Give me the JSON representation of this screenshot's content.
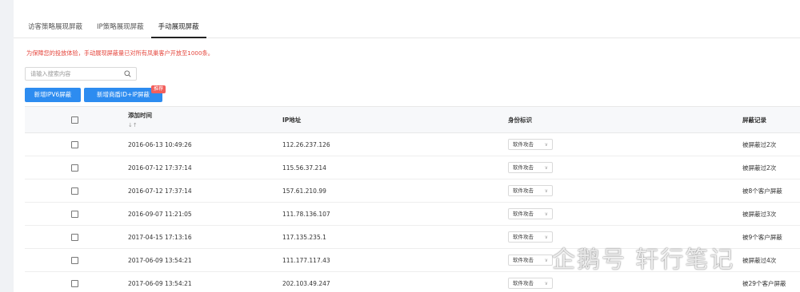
{
  "tabs": [
    {
      "label": "访客策略展现屏蔽",
      "active": false
    },
    {
      "label": "IP策略展现屏蔽",
      "active": false
    },
    {
      "label": "手动展现屏蔽",
      "active": true
    }
  ],
  "notice": "为保障您的投放体验，手动展现屏蔽量已对所有凤巢客户开放至1000条。",
  "search": {
    "placeholder": "请输入搜索内容",
    "value": "",
    "icon": "search-icon"
  },
  "buttons": {
    "add_ipv6": "新增IPV6屏蔽",
    "add_merchant": "新增商盾ID+IP屏蔽",
    "recommend_badge": "推荐"
  },
  "table": {
    "headers": {
      "time": "添加时间",
      "time_sort": "↓↑",
      "ip": "IP地址",
      "identity": "身份标识",
      "record": "屏蔽记录"
    },
    "rows": [
      {
        "time": "2016-06-13 10:49:26",
        "ip": "112.26.237.126",
        "identity": "软件攻击",
        "record": "被屏蔽过2次"
      },
      {
        "time": "2016-07-12 17:37:14",
        "ip": "115.56.37.214",
        "identity": "软件攻击",
        "record": "被屏蔽过2次"
      },
      {
        "time": "2016-07-12 17:37:14",
        "ip": "157.61.210.99",
        "identity": "软件攻击",
        "record": "被8个客户屏蔽"
      },
      {
        "time": "2016-09-07 11:21:05",
        "ip": "111.78.136.107",
        "identity": "软件攻击",
        "record": "被屏蔽过3次"
      },
      {
        "time": "2017-04-15 17:13:16",
        "ip": "117.135.235.1",
        "identity": "软件攻击",
        "record": "被9个客户屏蔽"
      },
      {
        "time": "2017-06-09 13:54:21",
        "ip": "111.177.117.43",
        "identity": "软件攻击",
        "record": "被屏蔽过4次"
      },
      {
        "time": "2017-06-09 13:54:21",
        "ip": "202.103.49.247",
        "identity": "软件攻击",
        "record": "被29个客户屏蔽"
      }
    ]
  },
  "watermark": "企鹅号 轩行笔记",
  "colors": {
    "primary": "#2d8cf0",
    "notice": "#e5473e",
    "badge": "#f25f5c"
  }
}
